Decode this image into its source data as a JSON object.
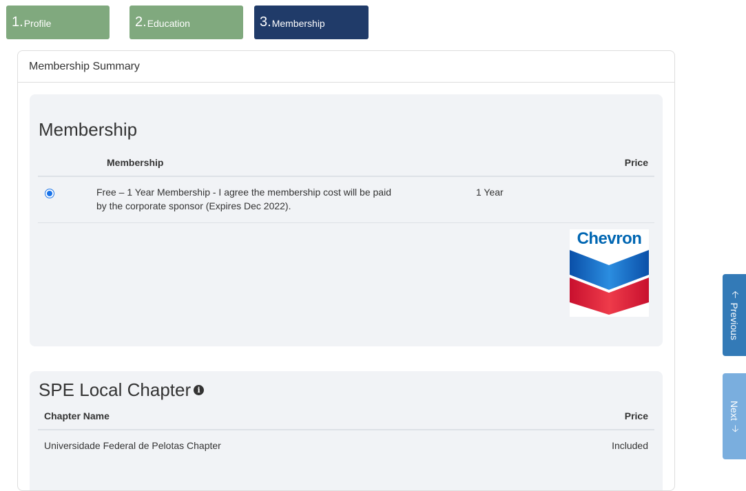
{
  "steps": [
    {
      "num": "1.",
      "label": "Profile",
      "state": "done"
    },
    {
      "num": "2.",
      "label": "Education",
      "state": "done"
    },
    {
      "num": "3.",
      "label": "Membership",
      "state": "active"
    }
  ],
  "panel": {
    "title": "Membership Summary"
  },
  "membership": {
    "heading": "Membership",
    "col_membership": "Membership",
    "col_price": "Price",
    "option": {
      "text_line1": "Free – 1 Year Membership - I agree the membership cost will be paid",
      "text_line2": "by the corporate sponsor (Expires Dec 2022).",
      "term": "1 Year",
      "selected": true
    },
    "sponsor_logo": {
      "text": "Chevron",
      "icon": "chevron-logo"
    }
  },
  "chapter": {
    "heading": "SPE Local Chapter",
    "info_icon": "info-icon",
    "col_name": "Chapter Name",
    "col_price": "Price",
    "row": {
      "name": "Universidade Federal de Pelotas Chapter",
      "price": "Included"
    }
  },
  "nav": {
    "previous_label": "Previous",
    "next_label": "Next"
  },
  "colors": {
    "step_done": "#80a97e",
    "step_active": "#203b69",
    "card_bg": "#f1f3f6",
    "previous_btn": "#337ab7",
    "next_btn": "#7aaede"
  }
}
